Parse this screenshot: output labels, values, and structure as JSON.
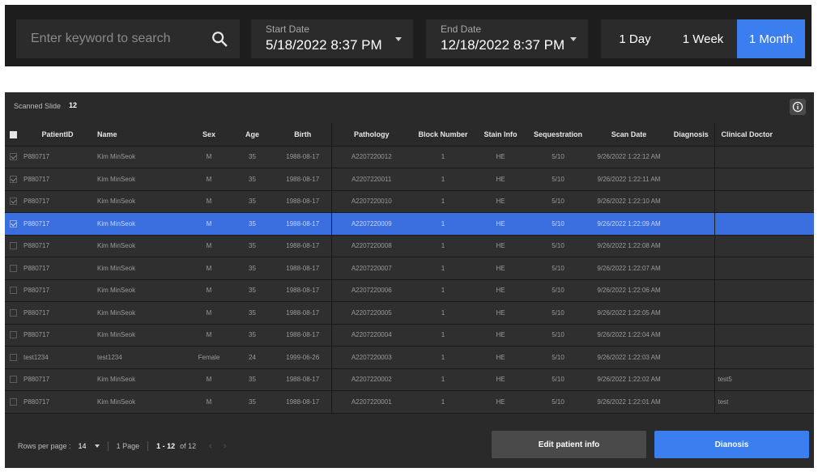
{
  "search": {
    "placeholder": "Enter keyword to search",
    "value": ""
  },
  "start_date": {
    "label": "Start Date",
    "value": "5/18/2022 8:37 PM"
  },
  "end_date": {
    "label": "End Date",
    "value": "12/18/2022 8:37 PM"
  },
  "ranges": [
    {
      "label": "1 Day",
      "active": false
    },
    {
      "label": "1 Week",
      "active": false
    },
    {
      "label": "1 Month",
      "active": true
    }
  ],
  "panel": {
    "title": "Scanned Slide",
    "count": "12"
  },
  "columns": [
    "PatientID",
    "Name",
    "Sex",
    "Age",
    "Birth",
    "Pathology",
    "Block Number",
    "Stain Info",
    "Sequestration",
    "Scan Date",
    "Diagnosis",
    "Clinical Doctor"
  ],
  "rows": [
    {
      "checked": true,
      "selected": false,
      "patient_id": "P880717",
      "name": "Kim MinSeok",
      "sex": "M",
      "age": "35",
      "birth": "1988-08-17",
      "pathology": "A2207220012",
      "block": "1",
      "stain": "HE",
      "seq": "5/10",
      "scan_date": "9/26/2022 1:22:12 AM",
      "diagnosis": "",
      "doctor": ""
    },
    {
      "checked": true,
      "selected": false,
      "patient_id": "P880717",
      "name": "Kim MinSeok",
      "sex": "M",
      "age": "35",
      "birth": "1988-08-17",
      "pathology": "A2207220011",
      "block": "1",
      "stain": "HE",
      "seq": "5/10",
      "scan_date": "9/26/2022 1:22:11 AM",
      "diagnosis": "",
      "doctor": ""
    },
    {
      "checked": true,
      "selected": false,
      "patient_id": "P880717",
      "name": "Kim MinSeok",
      "sex": "M",
      "age": "35",
      "birth": "1988-08-17",
      "pathology": "A2207220010",
      "block": "1",
      "stain": "HE",
      "seq": "5/10",
      "scan_date": "9/26/2022 1:22:10 AM",
      "diagnosis": "",
      "doctor": ""
    },
    {
      "checked": true,
      "selected": true,
      "patient_id": "P880717",
      "name": "Kim MinSeok",
      "sex": "M",
      "age": "35",
      "birth": "1988-08-17",
      "pathology": "A2207220009",
      "block": "1",
      "stain": "HE",
      "seq": "5/10",
      "scan_date": "9/26/2022 1:22:09 AM",
      "diagnosis": "",
      "doctor": ""
    },
    {
      "checked": false,
      "selected": false,
      "patient_id": "P880717",
      "name": "Kim MinSeok",
      "sex": "M",
      "age": "35",
      "birth": "1988-08-17",
      "pathology": "A2207220008",
      "block": "1",
      "stain": "HE",
      "seq": "5/10",
      "scan_date": "9/26/2022 1:22:08 AM",
      "diagnosis": "",
      "doctor": ""
    },
    {
      "checked": false,
      "selected": false,
      "patient_id": "P880717",
      "name": "Kim MinSeok",
      "sex": "M",
      "age": "35",
      "birth": "1988-08-17",
      "pathology": "A2207220007",
      "block": "1",
      "stain": "HE",
      "seq": "5/10",
      "scan_date": "9/26/2022 1:22:07 AM",
      "diagnosis": "",
      "doctor": ""
    },
    {
      "checked": false,
      "selected": false,
      "patient_id": "P880717",
      "name": "Kim MinSeok",
      "sex": "M",
      "age": "35",
      "birth": "1988-08-17",
      "pathology": "A2207220006",
      "block": "1",
      "stain": "HE",
      "seq": "5/10",
      "scan_date": "9/26/2022 1:22:06 AM",
      "diagnosis": "",
      "doctor": ""
    },
    {
      "checked": false,
      "selected": false,
      "patient_id": "P880717",
      "name": "Kim MinSeok",
      "sex": "M",
      "age": "35",
      "birth": "1988-08-17",
      "pathology": "A2207220005",
      "block": "1",
      "stain": "HE",
      "seq": "5/10",
      "scan_date": "9/26/2022 1:22:05 AM",
      "diagnosis": "",
      "doctor": ""
    },
    {
      "checked": false,
      "selected": false,
      "patient_id": "P880717",
      "name": "Kim MinSeok",
      "sex": "M",
      "age": "35",
      "birth": "1988-08-17",
      "pathology": "A2207220004",
      "block": "1",
      "stain": "HE",
      "seq": "5/10",
      "scan_date": "9/26/2022 1:22:04 AM",
      "diagnosis": "",
      "doctor": ""
    },
    {
      "checked": false,
      "selected": false,
      "patient_id": "test1234",
      "name": "test1234",
      "sex": "Female",
      "age": "24",
      "birth": "1999-06-26",
      "pathology": "A2207220003",
      "block": "1",
      "stain": "HE",
      "seq": "5/10",
      "scan_date": "9/26/2022 1:22:03 AM",
      "diagnosis": "",
      "doctor": ""
    },
    {
      "checked": false,
      "selected": false,
      "patient_id": "P880717",
      "name": "Kim MinSeok",
      "sex": "M",
      "age": "35",
      "birth": "1988-08-17",
      "pathology": "A2207220002",
      "block": "1",
      "stain": "HE",
      "seq": "5/10",
      "scan_date": "9/26/2022 1:22:02 AM",
      "diagnosis": "",
      "doctor": "test5"
    },
    {
      "checked": false,
      "selected": false,
      "patient_id": "P880717",
      "name": "Kim MinSeok",
      "sex": "M",
      "age": "35",
      "birth": "1988-08-17",
      "pathology": "A2207220001",
      "block": "1",
      "stain": "HE",
      "seq": "5/10",
      "scan_date": "9/26/2022 1:22:01 AM",
      "diagnosis": "",
      "doctor": "test"
    }
  ],
  "pager": {
    "rows_label": "Rows per page :",
    "rows_value": "14",
    "page_label": "1 Page",
    "range": "1 - 12",
    "of_label": "of 12",
    "prev": "‹",
    "next": "›"
  },
  "buttons": {
    "edit": "Edit patient info",
    "diagnosis": "Dianosis"
  },
  "colors": {
    "accent": "#3b7ef0",
    "panel": "#2a2a2a",
    "row": "#2f2f2f",
    "selected": "#3b6fe0"
  }
}
